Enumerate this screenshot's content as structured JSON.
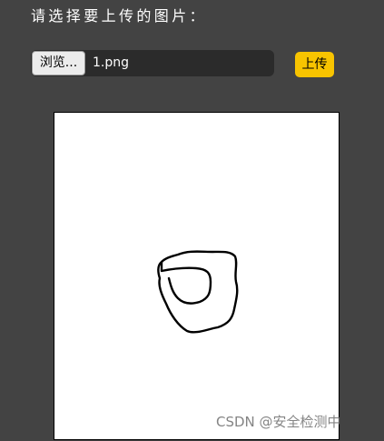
{
  "upload_form": {
    "prompt": "请选择要上传的图片：",
    "browse_label": "浏览...",
    "selected_file": "1.png",
    "upload_label": "上传"
  },
  "preview": {
    "drawing": "hand-drawn-loop"
  },
  "watermark": "CSDN @安全检测中",
  "colors": {
    "background": "#434343",
    "file_field": "#2b2b2b",
    "upload_button": "#f8c400",
    "preview_bg": "#ffffff"
  }
}
